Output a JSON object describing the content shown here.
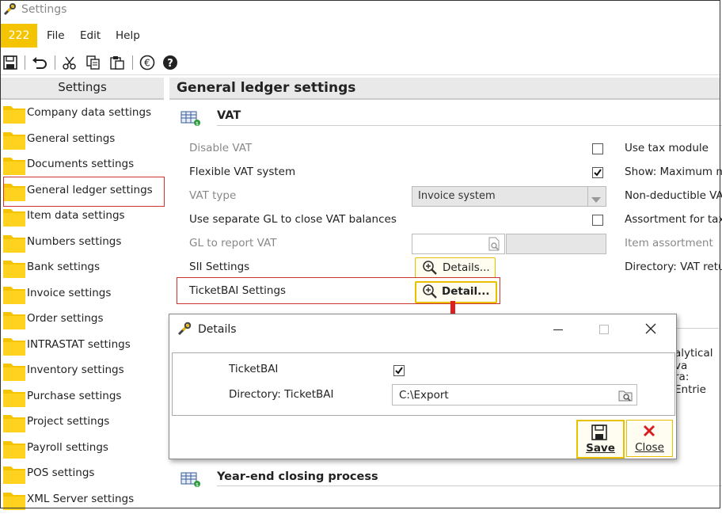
{
  "window": {
    "title": "Settings"
  },
  "menubar": {
    "badge": "222",
    "items": [
      "File",
      "Edit",
      "Help"
    ]
  },
  "toolbar": {
    "icons": [
      "save-icon",
      "undo-icon",
      "cut-icon",
      "copy-icon",
      "paste-icon",
      "euro-icon",
      "help-icon"
    ]
  },
  "left": {
    "header": "Settings",
    "items": [
      "Company data settings",
      "General settings",
      "Documents settings",
      "General ledger settings",
      "Item data settings",
      "Numbers settings",
      "Bank settings",
      "Invoice settings",
      "Order settings",
      "INTRASTAT settings",
      "Inventory settings",
      "Purchase settings",
      "Project settings",
      "Payroll settings",
      "POS settings",
      "XML Server settings"
    ],
    "selected": "General ledger settings"
  },
  "main": {
    "title": "General ledger settings",
    "vat_section": "VAT",
    "rows": {
      "disable_vat": "Disable VAT",
      "flexible_vat": "Flexible VAT system",
      "vat_type": "VAT type",
      "separate_gl": "Use separate GL to close VAT balances",
      "gl_report": "GL to report VAT",
      "sii": "SII Settings",
      "ticketbai": "TicketBAI Settings"
    },
    "vat_type_value": "Invoice system",
    "sii_button": "Details...",
    "ticketbai_button": "Detail...",
    "right_col": [
      "Use tax module",
      "Show: Maximum n",
      "Non-deductible VA",
      "Assortment for tax",
      "Item assortment",
      "Directory: VAT retu"
    ],
    "partial_right": [
      "alytical va",
      "ra: Entrie"
    ],
    "yearend_section": "Year-end closing process"
  },
  "dialog": {
    "title": "Details",
    "ticketbai_label": "TicketBAI",
    "directory_label": "Directory: TicketBAI",
    "directory_value": "C:\\Export",
    "save": "Save",
    "close": "Close"
  },
  "checks": {
    "disable_vat": false,
    "flexible_vat": true,
    "separate_gl": false,
    "use_tax_module": false,
    "dialog_ticketbai": true
  },
  "colors": {
    "accent": "#f5c400",
    "folder": "#f5c400",
    "highlight_box": "#cc3333",
    "arrow": "#e02020"
  }
}
